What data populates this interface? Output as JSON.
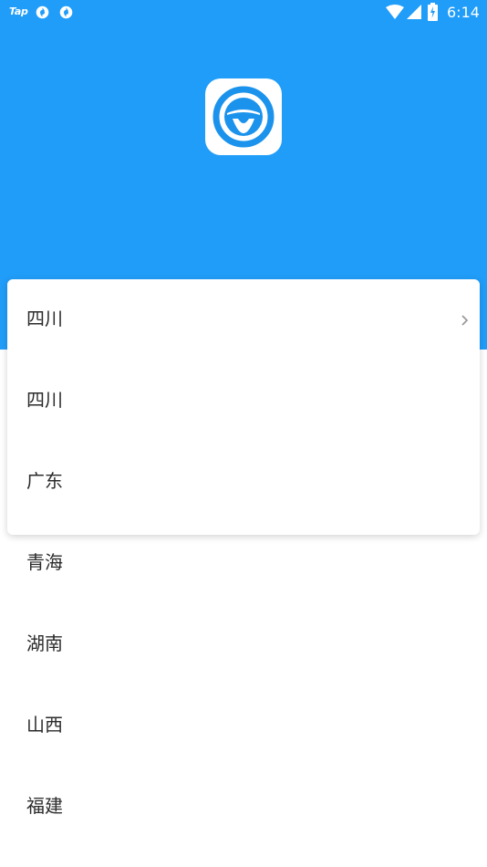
{
  "status_bar": {
    "left_text": "Tap",
    "time": "6:14",
    "icons": [
      "sync-icon",
      "sync-icon",
      "wifi-icon",
      "signal-icon",
      "battery-charging-icon"
    ]
  },
  "colors": {
    "header_bg": "#209df9",
    "logo_blue": "#1b93ec",
    "text": "#2b2b2b",
    "chevron": "#9a9a9a"
  },
  "logo": {
    "icon": "steering-wheel-icon"
  },
  "dropdown": {
    "selected": "四川",
    "chevron_icon": "chevron-right-icon"
  },
  "provinces": [
    "四川",
    "广东",
    "青海",
    "湖南",
    "山西",
    "福建"
  ]
}
